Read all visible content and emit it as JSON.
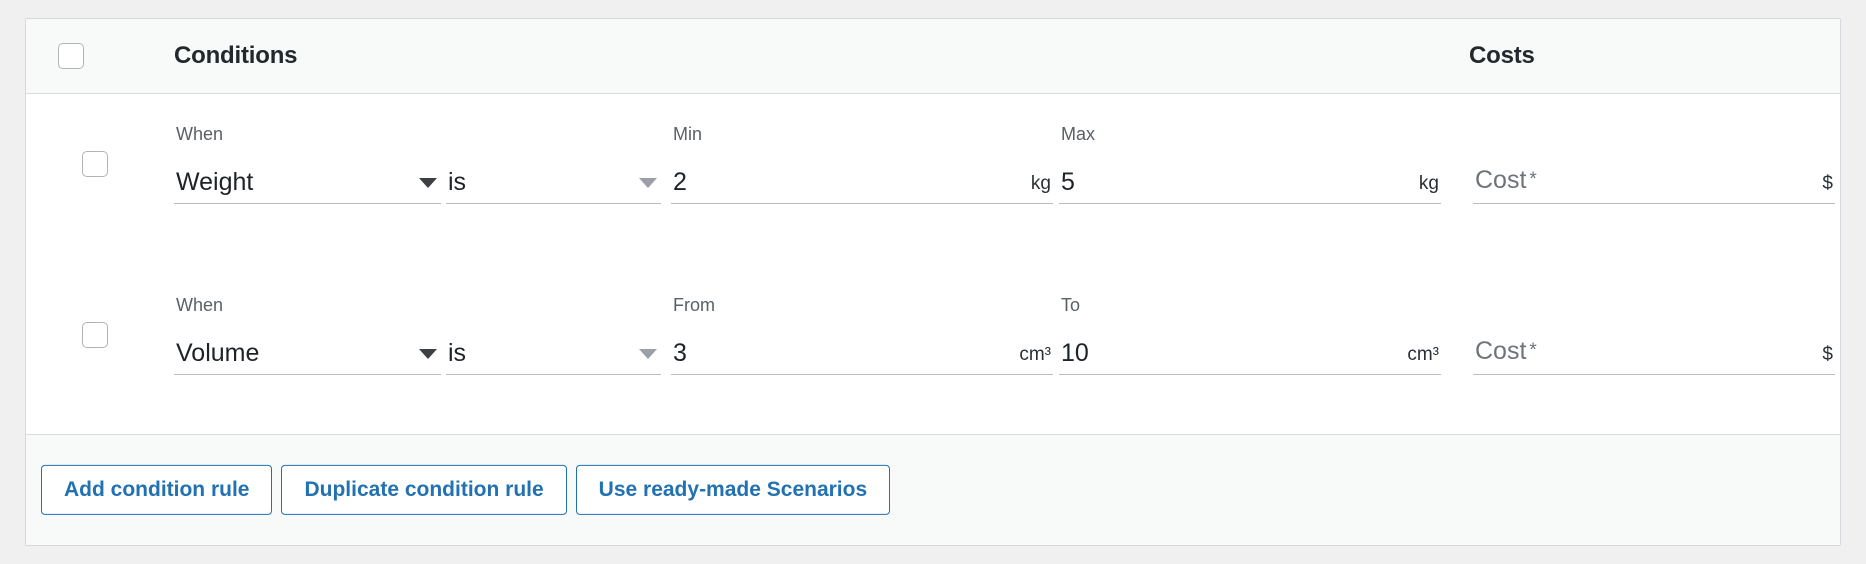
{
  "header": {
    "select_all_checkbox": "unchecked",
    "conditions_label": "Conditions",
    "costs_label": "Costs"
  },
  "rows": [
    {
      "selected": false,
      "when": {
        "label": "When",
        "value": "Weight",
        "caret": "chevron-down-icon"
      },
      "operator": {
        "label": "",
        "value": "is",
        "caret": "chevron-down-icon"
      },
      "lower": {
        "label": "Min",
        "value": "2",
        "unit": "kg"
      },
      "upper": {
        "label": "Max",
        "value": "5",
        "unit": "kg"
      },
      "cost": {
        "label": "",
        "placeholder": "Cost",
        "required_mark": "*",
        "value": "",
        "currency": "$"
      }
    },
    {
      "selected": false,
      "when": {
        "label": "When",
        "value": "Volume",
        "caret": "chevron-down-icon"
      },
      "operator": {
        "label": "",
        "value": "is",
        "caret": "chevron-down-icon"
      },
      "lower": {
        "label": "From",
        "value": "3",
        "unit": "cm³"
      },
      "upper": {
        "label": "To",
        "value": "10",
        "unit": "cm³"
      },
      "cost": {
        "label": "",
        "placeholder": "Cost",
        "required_mark": "*",
        "value": "",
        "currency": "$"
      }
    }
  ],
  "footer": {
    "buttons": [
      {
        "label": "Add condition rule"
      },
      {
        "label": "Duplicate condition rule"
      },
      {
        "label": "Use ready-made Scenarios"
      }
    ]
  },
  "colors": {
    "accent_blue": "#2271b1",
    "panel_bg": "#ffffff",
    "header_bg": "#f8f9f9",
    "page_bg": "#f0f0f0",
    "border": "#d5d8dc",
    "text_primary": "#1d2327",
    "text_muted": "#5a6066"
  }
}
